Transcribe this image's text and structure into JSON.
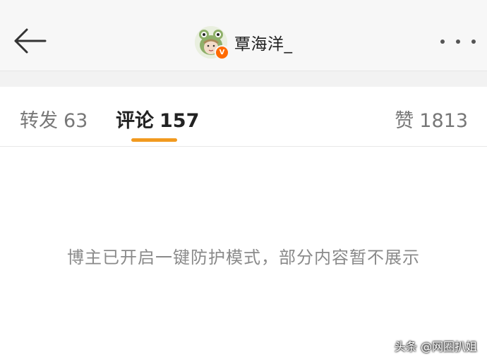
{
  "header": {
    "username": "覃海洋_",
    "verified_badge": "V",
    "icons": {
      "back": "back-arrow-icon",
      "more": "more-dots-icon"
    }
  },
  "tabs": [
    {
      "label": "转发",
      "count": "63",
      "active": false
    },
    {
      "label": "评论",
      "count": "157",
      "active": true
    },
    {
      "label": "赞",
      "count": "1813",
      "active": false
    }
  ],
  "colors": {
    "accent": "#f19a1f",
    "verified": "#ff6a00"
  },
  "message": "博主已开启一键防护模式，部分内容暂不展示",
  "watermark": "头条 @网圈扒姐"
}
